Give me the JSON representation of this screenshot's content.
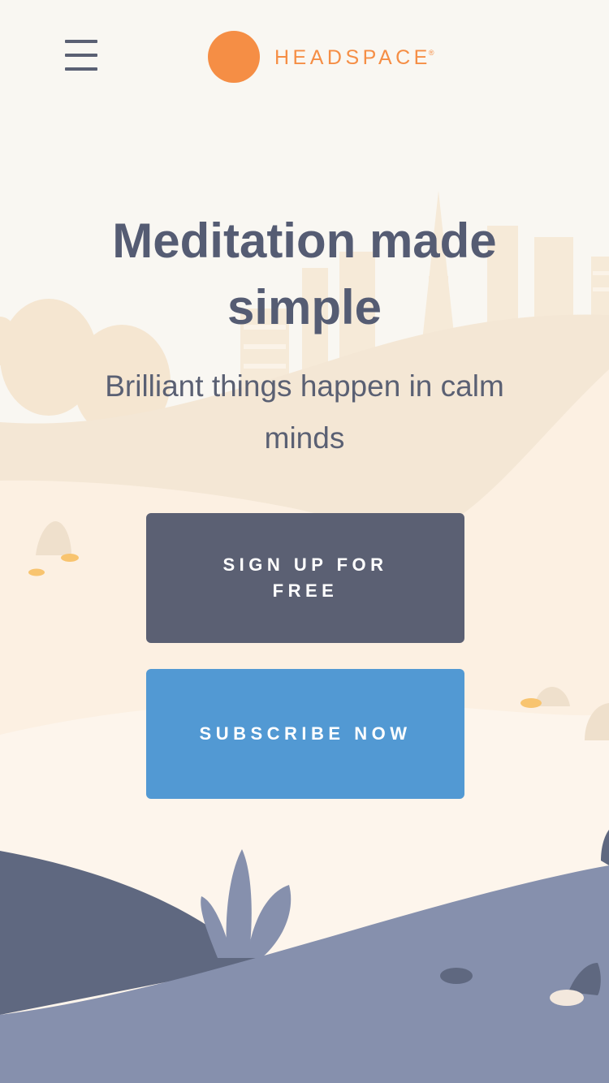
{
  "header": {
    "menu_icon": "hamburger-menu-icon",
    "logo_text": "HEADSPACE",
    "logo_mark": "®",
    "brand_color": "#f58e45"
  },
  "hero": {
    "title": "Meditation made simple",
    "subtitle": "Brilliant things happen in calm minds"
  },
  "buttons": {
    "signup_label": "SIGN UP FOR FREE",
    "subscribe_label": "SUBSCRIBE NOW",
    "signup_color": "#5b6073",
    "subscribe_color": "#5299d3"
  }
}
